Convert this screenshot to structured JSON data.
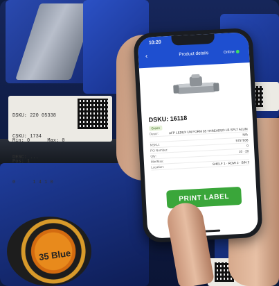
{
  "photo": {
    "left_tag": {
      "line1": "DSKU: 220 05338",
      "line2": "CSKU: 1734",
      "line3": "DESC: ...",
      "line4": "Min: 0      Max: 0",
      "line5": "Pos: 1",
      "line6": "0      1 4 1 0"
    },
    "tape_label": "35 Blue"
  },
  "app": {
    "status_time": "10:20",
    "title": "Product details",
    "status": "Online",
    "dsku_label": "DSKU: 16118",
    "badge": "Green",
    "details": [
      {
        "key": "Descr:",
        "value": "AFP LEDEX UN FORM 85 THREADED LB SPLT ALUM"
      },
      {
        "key": "",
        "value": "N/A"
      },
      {
        "key": "NSKU:",
        "value": "5757938"
      },
      {
        "key": "PO Number:",
        "value": "0"
      },
      {
        "key": "Qty:",
        "value": "10 · 20"
      },
      {
        "key": "Min/Max:",
        "value": ""
      },
      {
        "key": "Location:",
        "value": "SHELF 1 · ROW 2 · BIN 2"
      }
    ],
    "print_button": "PRINT LABEL"
  },
  "colors": {
    "app_bar": "#1e4fd0",
    "print_button": "#3aa63a",
    "bins": "#1f3da0"
  }
}
